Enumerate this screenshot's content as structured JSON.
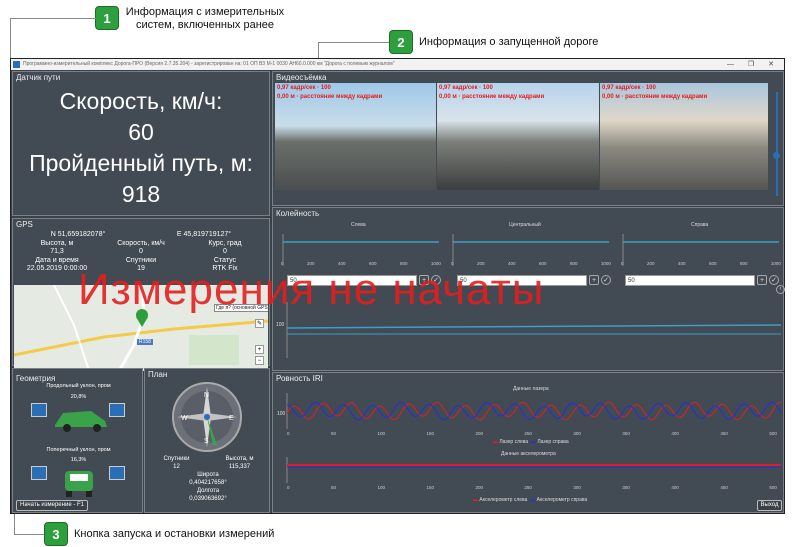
{
  "callouts": [
    {
      "num": "1",
      "text": "Информация с измерительных\nсистем, включенных ранее"
    },
    {
      "num": "2",
      "text": "Информация о запущенной дороге"
    },
    {
      "num": "3",
      "text": "Кнопка запуска и остановки измерений"
    }
  ],
  "window": {
    "title": "Программно-измерительный комплекс Дорога-ПРО (Версия 2.7.35.204) - зарегистрирован на: 01 ОП ВЗ М-1 0030 АН60.0.000 км \"Дорога с полевым журналом\"",
    "controls": "— ❐ ✕"
  },
  "speed_panel": {
    "title": "Датчик пути",
    "speed_label": "Скорость, км/ч:",
    "speed_value": "60",
    "distance_label": "Пройденный путь, м:",
    "distance_value": "918"
  },
  "gps": {
    "title": "GPS",
    "lat": "N 51,659182078°",
    "lon": "E 45,819719127°",
    "headers1": [
      "Высота, м",
      "Скорость, км/ч",
      "Курс, град"
    ],
    "values1": [
      "71,3",
      "0",
      "0"
    ],
    "headers2": [
      "Дата и время",
      "Спутники",
      "Статус"
    ],
    "values2": [
      "22.05.2019 0:00:00",
      "19",
      "RTK Fix"
    ],
    "map_tooltip": "Где я? (основной GPS)",
    "map_road": "R158",
    "map_buttons": [
      "✎",
      "+",
      "−"
    ]
  },
  "geometry": {
    "title": "Геометрия",
    "long_label": "Продольный уклон, пром",
    "long_value": "20,8%",
    "cross_label": "Поперечный уклон, пром",
    "cross_value": "16,3%"
  },
  "plan": {
    "title": "План",
    "h1": [
      "Спутники",
      "Высота, м"
    ],
    "v1": [
      "12",
      "115,337"
    ],
    "lat_label": "Широта",
    "lat_value": "0,404217658°",
    "lon_label": "Долгота",
    "lon_value": "0,039063692°"
  },
  "video": {
    "title": "Видеосъёмка",
    "line1": "0,97 кадр/сек · 100",
    "line2": "0,00 м · расстояние между кадрами"
  },
  "rut": {
    "title": "Колейность",
    "columns": [
      "Слева",
      "Центральный",
      "Справа"
    ],
    "inputs": [
      "50",
      "50",
      "50"
    ],
    "x_ticks": [
      "0",
      "200",
      "400",
      "600",
      "800",
      "1000"
    ],
    "y_tick": "100"
  },
  "iri": {
    "title": "Ровность IRI",
    "laser_title": "Данные лазера",
    "laser_y": "100",
    "laser_legend": [
      "Лазер слева",
      "Лазер справа"
    ],
    "accel_title": "Данные акселерометра",
    "accel_legend": [
      "Акселерометр слева",
      "Акселерометр справа"
    ],
    "x_ticks": [
      "0",
      "50",
      "100",
      "150",
      "200",
      "250",
      "300",
      "350",
      "400",
      "450",
      "500"
    ]
  },
  "buttons": {
    "start": "Начать измерение - F1",
    "exit": "Выход"
  },
  "overlay": "Измерения не начаты",
  "colors": {
    "badge": "#2e9f3d",
    "overlay": "#e41e1e",
    "series_red": "#e02020",
    "series_blue": "#2030e0",
    "series_cyan": "#3aa0c8"
  }
}
